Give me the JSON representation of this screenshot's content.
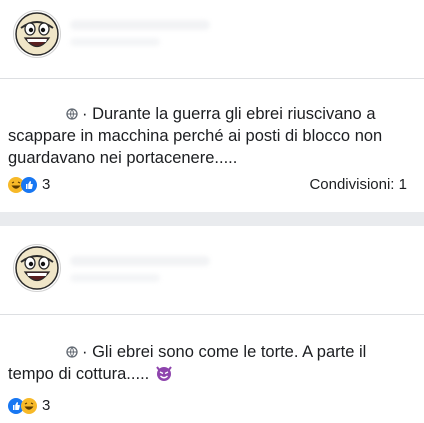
{
  "posts": [
    {
      "text": "Durante la guerra gli ebrei riuscivano a scappare in macchina perché ai posti di blocco non guardavano nei portacenere.....",
      "reaction_count": "3",
      "reactions": [
        "haha-reaction-icon",
        "like-reaction-icon"
      ],
      "shares": "Condivisioni: 1"
    },
    {
      "text": "Gli ebrei sono come le torte. A parte il tempo di cottura.....",
      "trailing_emoji": "devil-emoji-icon",
      "reaction_count": "3",
      "reactions": [
        "like-reaction-icon",
        "haha-reaction-icon"
      ]
    }
  ],
  "colors": {
    "like_blue": "#1877f2",
    "haha_yellow": "#f7b928",
    "devil_purple": "#8e44ad",
    "page_bg": "#e9ebee"
  }
}
